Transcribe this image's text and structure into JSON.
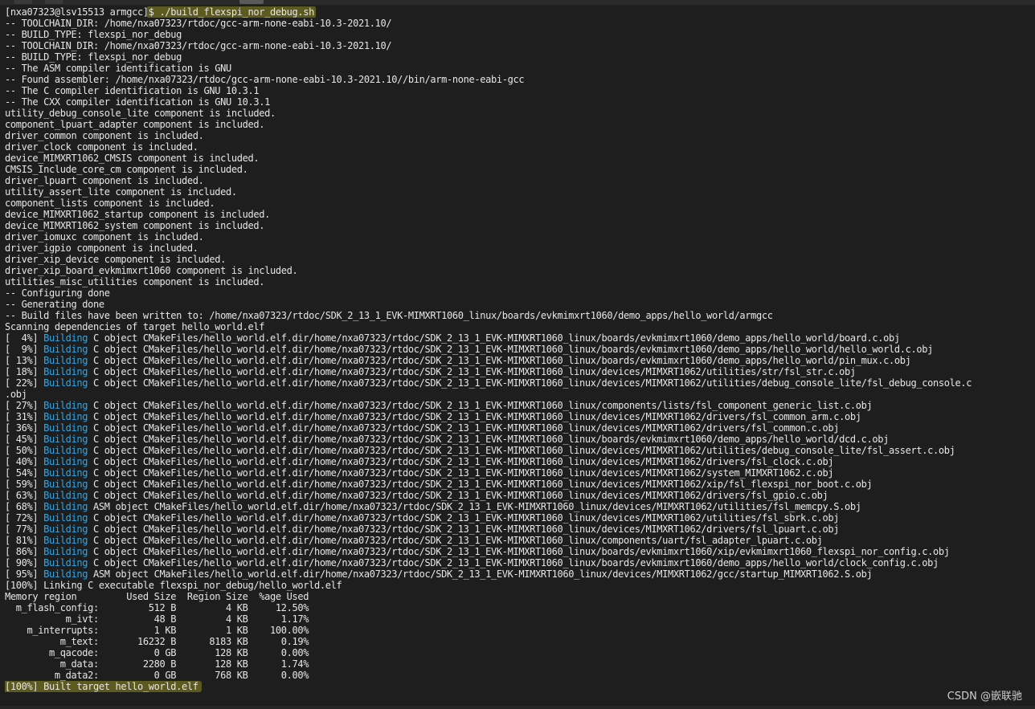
{
  "prompt": "[nxa07323@lsv15513 armgcc]",
  "command": "$ ./build_flexspi_nor_debug.sh",
  "lines": [
    "-- TOOLCHAIN_DIR: /home/nxa07323/rtdoc/gcc-arm-none-eabi-10.3-2021.10/",
    "-- BUILD_TYPE: flexspi_nor_debug",
    "-- TOOLCHAIN_DIR: /home/nxa07323/rtdoc/gcc-arm-none-eabi-10.3-2021.10/",
    "-- BUILD_TYPE: flexspi_nor_debug",
    "-- The ASM compiler identification is GNU",
    "-- Found assembler: /home/nxa07323/rtdoc/gcc-arm-none-eabi-10.3-2021.10//bin/arm-none-eabi-gcc",
    "-- The C compiler identification is GNU 10.3.1",
    "-- The CXX compiler identification is GNU 10.3.1",
    "utility_debug_console_lite component is included.",
    "component_lpuart_adapter component is included.",
    "driver_common component is included.",
    "driver_clock component is included.",
    "device_MIMXRT1062_CMSIS component is included.",
    "CMSIS_Include_core_cm component is included.",
    "driver_lpuart component is included.",
    "utility_assert_lite component is included.",
    "component_lists component is included.",
    "device_MIMXRT1062_startup component is included.",
    "device_MIMXRT1062_system component is included.",
    "driver_iomuxc component is included.",
    "driver_igpio component is included.",
    "driver_xip_device component is included.",
    "driver_xip_board_evkmimxrt1060 component is included.",
    "utilities_misc_utilities component is included.",
    "-- Configuring done",
    "-- Generating done",
    "-- Build files have been written to: /home/nxa07323/rtdoc/SDK_2_13_1_EVK-MIMXRT1060_linux/boards/evkmimxrt1060/demo_apps/hello_world/armgcc",
    "Scanning dependencies of target hello_world.elf"
  ],
  "build_keyword": "Building",
  "build_lines": [
    {
      "pct": "[  4%] ",
      "rest": " C object CMakeFiles/hello_world.elf.dir/home/nxa07323/rtdoc/SDK_2_13_1_EVK-MIMXRT1060_linux/boards/evkmimxrt1060/demo_apps/hello_world/board.c.obj"
    },
    {
      "pct": "[  9%] ",
      "rest": " C object CMakeFiles/hello_world.elf.dir/home/nxa07323/rtdoc/SDK_2_13_1_EVK-MIMXRT1060_linux/boards/evkmimxrt1060/demo_apps/hello_world/hello_world.c.obj"
    },
    {
      "pct": "[ 13%] ",
      "rest": " C object CMakeFiles/hello_world.elf.dir/home/nxa07323/rtdoc/SDK_2_13_1_EVK-MIMXRT1060_linux/boards/evkmimxrt1060/demo_apps/hello_world/pin_mux.c.obj"
    },
    {
      "pct": "[ 18%] ",
      "rest": " C object CMakeFiles/hello_world.elf.dir/home/nxa07323/rtdoc/SDK_2_13_1_EVK-MIMXRT1060_linux/devices/MIMXRT1062/utilities/str/fsl_str.c.obj"
    },
    {
      "pct": "[ 22%] ",
      "rest": " C object CMakeFiles/hello_world.elf.dir/home/nxa07323/rtdoc/SDK_2_13_1_EVK-MIMXRT1060_linux/devices/MIMXRT1062/utilities/debug_console_lite/fsl_debug_console.c",
      "wrap": ".obj"
    },
    {
      "pct": "[ 27%] ",
      "rest": " C object CMakeFiles/hello_world.elf.dir/home/nxa07323/rtdoc/SDK_2_13_1_EVK-MIMXRT1060_linux/components/lists/fsl_component_generic_list.c.obj"
    },
    {
      "pct": "[ 31%] ",
      "rest": " C object CMakeFiles/hello_world.elf.dir/home/nxa07323/rtdoc/SDK_2_13_1_EVK-MIMXRT1060_linux/devices/MIMXRT1062/drivers/fsl_common_arm.c.obj"
    },
    {
      "pct": "[ 36%] ",
      "rest": " C object CMakeFiles/hello_world.elf.dir/home/nxa07323/rtdoc/SDK_2_13_1_EVK-MIMXRT1060_linux/devices/MIMXRT1062/drivers/fsl_common.c.obj"
    },
    {
      "pct": "[ 45%] ",
      "rest": " C object CMakeFiles/hello_world.elf.dir/home/nxa07323/rtdoc/SDK_2_13_1_EVK-MIMXRT1060_linux/boards/evkmimxrt1060/demo_apps/hello_world/dcd.c.obj"
    },
    {
      "pct": "[ 50%] ",
      "rest": " C object CMakeFiles/hello_world.elf.dir/home/nxa07323/rtdoc/SDK_2_13_1_EVK-MIMXRT1060_linux/devices/MIMXRT1062/utilities/debug_console_lite/fsl_assert.c.obj"
    },
    {
      "pct": "[ 40%] ",
      "rest": " C object CMakeFiles/hello_world.elf.dir/home/nxa07323/rtdoc/SDK_2_13_1_EVK-MIMXRT1060_linux/devices/MIMXRT1062/drivers/fsl_clock.c.obj"
    },
    {
      "pct": "[ 54%] ",
      "rest": " C object CMakeFiles/hello_world.elf.dir/home/nxa07323/rtdoc/SDK_2_13_1_EVK-MIMXRT1060_linux/devices/MIMXRT1062/system_MIMXRT1062.c.obj"
    },
    {
      "pct": "[ 59%] ",
      "rest": " C object CMakeFiles/hello_world.elf.dir/home/nxa07323/rtdoc/SDK_2_13_1_EVK-MIMXRT1060_linux/devices/MIMXRT1062/xip/fsl_flexspi_nor_boot.c.obj"
    },
    {
      "pct": "[ 63%] ",
      "rest": " C object CMakeFiles/hello_world.elf.dir/home/nxa07323/rtdoc/SDK_2_13_1_EVK-MIMXRT1060_linux/devices/MIMXRT1062/drivers/fsl_gpio.c.obj"
    },
    {
      "pct": "[ 68%] ",
      "rest": " ASM object CMakeFiles/hello_world.elf.dir/home/nxa07323/rtdoc/SDK_2_13_1_EVK-MIMXRT1060_linux/devices/MIMXRT1062/utilities/fsl_memcpy.S.obj"
    },
    {
      "pct": "[ 72%] ",
      "rest": " C object CMakeFiles/hello_world.elf.dir/home/nxa07323/rtdoc/SDK_2_13_1_EVK-MIMXRT1060_linux/devices/MIMXRT1062/utilities/fsl_sbrk.c.obj"
    },
    {
      "pct": "[ 77%] ",
      "rest": " C object CMakeFiles/hello_world.elf.dir/home/nxa07323/rtdoc/SDK_2_13_1_EVK-MIMXRT1060_linux/devices/MIMXRT1062/drivers/fsl_lpuart.c.obj"
    },
    {
      "pct": "[ 81%] ",
      "rest": " C object CMakeFiles/hello_world.elf.dir/home/nxa07323/rtdoc/SDK_2_13_1_EVK-MIMXRT1060_linux/components/uart/fsl_adapter_lpuart.c.obj"
    },
    {
      "pct": "[ 86%] ",
      "rest": " C object CMakeFiles/hello_world.elf.dir/home/nxa07323/rtdoc/SDK_2_13_1_EVK-MIMXRT1060_linux/boards/evkmimxrt1060/xip/evkmimxrt1060_flexspi_nor_config.c.obj"
    },
    {
      "pct": "[ 90%] ",
      "rest": " C object CMakeFiles/hello_world.elf.dir/home/nxa07323/rtdoc/SDK_2_13_1_EVK-MIMXRT1060_linux/boards/evkmimxrt1060/demo_apps/hello_world/clock_config.c.obj"
    },
    {
      "pct": "[ 95%] ",
      "rest": " ASM object CMakeFiles/hello_world.elf.dir/home/nxa07323/rtdoc/SDK_2_13_1_EVK-MIMXRT1060_linux/devices/MIMXRT1062/gcc/startup_MIMXRT1062.S.obj"
    }
  ],
  "link_line": "[100%] Linking C executable flexspi_nor_debug/hello_world.elf",
  "memory_header": "Memory region         Used Size  Region Size  %age Used",
  "memory_rows": [
    "  m_flash_config:         512 B         4 KB     12.50%",
    "           m_ivt:          48 B         4 KB      1.17%",
    "    m_interrupts:          1 KB         1 KB    100.00%",
    "          m_text:       16232 B      8183 KB      0.19%",
    "        m_qacode:          0 GB       128 KB      0.00%",
    "          m_data:        2280 B       128 KB      1.74%",
    "         m_data2:          0 GB       768 KB      0.00%"
  ],
  "built_line": "[100%] Built target hello_world.elf",
  "watermark": "CSDN @嵌联驰",
  "colors": {
    "building_keyword": "#32a6e6",
    "highlight": "#5c5a1e",
    "background": "#1e1e1e"
  }
}
